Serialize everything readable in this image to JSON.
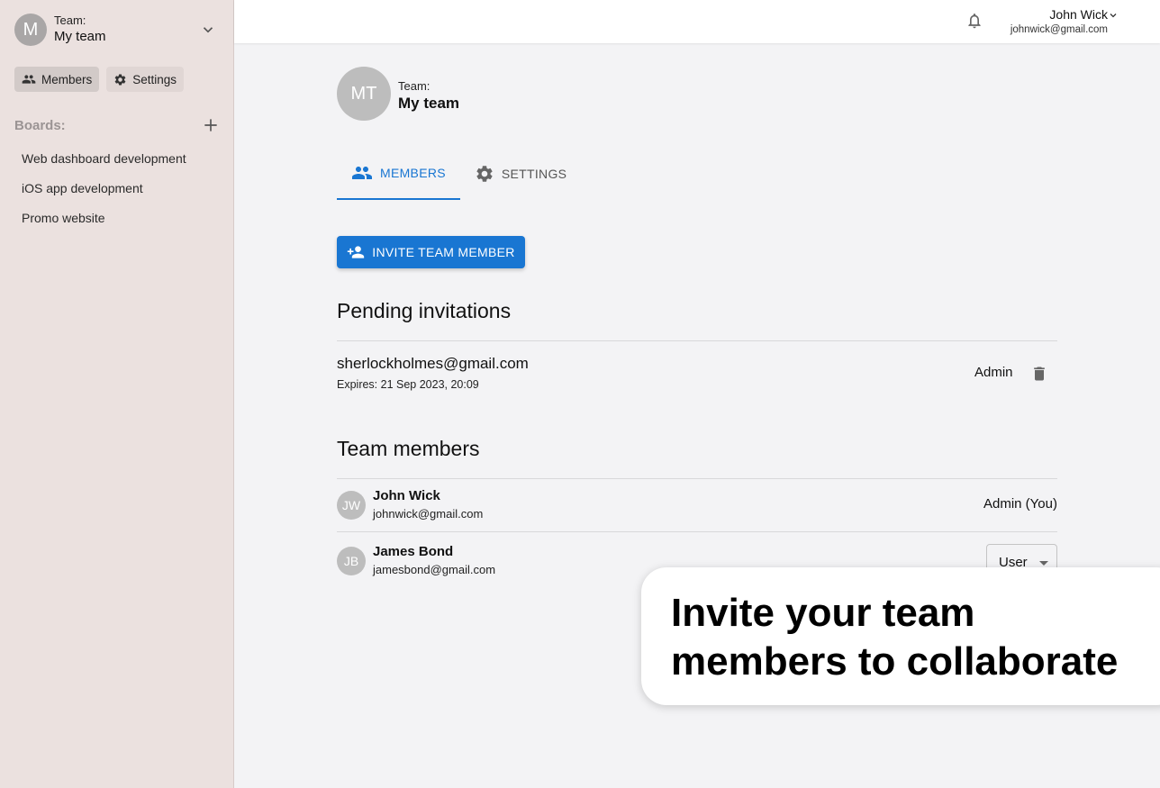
{
  "sidebar": {
    "team_label": "Team:",
    "team_name": "My team",
    "team_initial": "M",
    "nav": {
      "members": "Members",
      "settings": "Settings"
    },
    "boards_label": "Boards:",
    "boards": [
      "Web dashboard development",
      "iOS app development",
      "Promo website"
    ]
  },
  "topbar": {
    "user_name": "John Wick",
    "user_email": "johnwick@gmail.com"
  },
  "main": {
    "team_initials": "MT",
    "team_label": "Team:",
    "team_name": "My team",
    "tabs": {
      "members": "MEMBERS",
      "settings": "SETTINGS"
    },
    "invite_button": "INVITE TEAM MEMBER",
    "pending_title": "Pending invitations",
    "pending": [
      {
        "email": "sherlockholmes@gmail.com",
        "expires": "Expires: 21 Sep 2023, 20:09",
        "role": "Admin"
      }
    ],
    "members_title": "Team members",
    "members": [
      {
        "initials": "JW",
        "name": "John Wick",
        "email": "johnwick@gmail.com",
        "role": "Admin (You)"
      },
      {
        "initials": "JB",
        "name": "James Bond",
        "email": "jamesbond@gmail.com",
        "role": "User"
      }
    ]
  },
  "callout": {
    "text": "Invite your team members to collaborate"
  },
  "colors": {
    "accent": "#1976d2",
    "sidebar_bg": "#ebe1df",
    "page_bg": "#f3f3f5"
  }
}
